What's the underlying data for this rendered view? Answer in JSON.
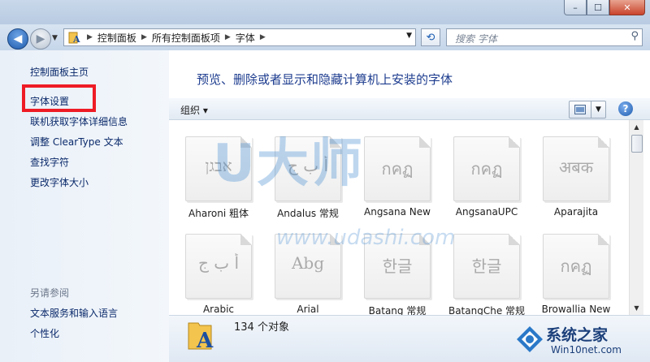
{
  "window": {
    "caption": {
      "minimize": "–",
      "maximize": "☐",
      "close": "✕"
    }
  },
  "address": {
    "crumbs": [
      "控制面板",
      "所有控制面板项",
      "字体"
    ]
  },
  "search": {
    "placeholder": "搜索 字体"
  },
  "sidebar": {
    "home": "控制面板主页",
    "items": [
      "字体设置",
      "联机获取字体详细信息",
      "调整 ClearType 文本",
      "查找字符",
      "更改字体大小"
    ],
    "see_also_title": "另请参阅",
    "see_also": [
      "文本服务和输入语言",
      "个性化"
    ]
  },
  "main": {
    "heading": "预览、删除或者显示和隐藏计算机上安装的字体",
    "organize": "组织 ▾"
  },
  "fonts": [
    {
      "name": "Aharoni 粗体",
      "sample": "אבגן"
    },
    {
      "name": "Andalus 常规",
      "sample": "أ ب ج"
    },
    {
      "name": "Angsana New",
      "sample": "กคฏ"
    },
    {
      "name": "AngsanaUPC",
      "sample": "กคฏ"
    },
    {
      "name": "Aparajita",
      "sample": "अबक"
    },
    {
      "name": "Arabic",
      "sample": "أ ب ج"
    },
    {
      "name": "Arial",
      "sample": "Abg"
    },
    {
      "name": "Batang 常规",
      "sample": "한글"
    },
    {
      "name": "BatangChe 常规",
      "sample": "한글"
    },
    {
      "name": "Browallia New",
      "sample": "กคฏ"
    }
  ],
  "status": {
    "count": "134 个对象"
  },
  "watermark": {
    "logo": "U大师",
    "url": "www.udashi.com"
  },
  "brand": {
    "name": "系统之家",
    "url": "Win10net.com"
  },
  "colors": {
    "highlight": "#ee1c25",
    "link": "#0b2a6b",
    "heading": "#1e3d8f"
  }
}
